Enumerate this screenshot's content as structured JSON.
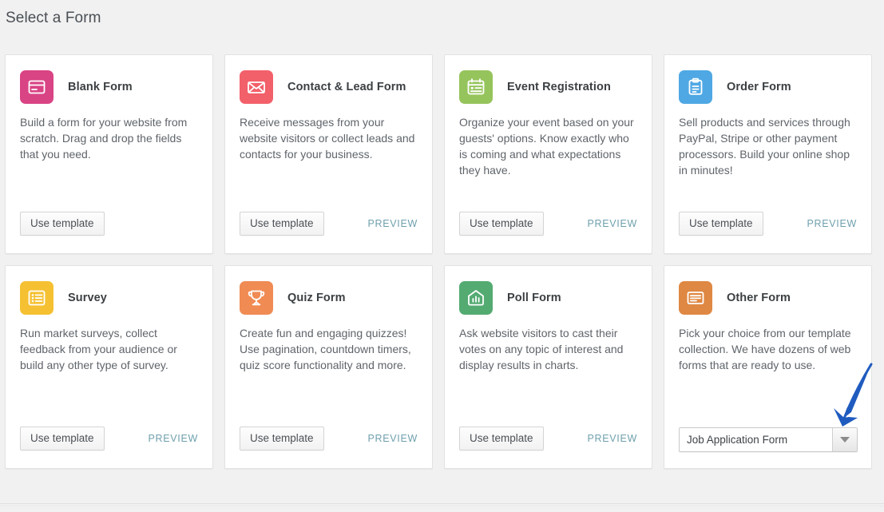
{
  "page": {
    "title": "Select a Form",
    "background_color": "#f1f1f1"
  },
  "labels": {
    "use_template": "Use template",
    "preview": "PREVIEW"
  },
  "cards": [
    {
      "id": "blank-form",
      "title": "Blank Form",
      "description": "Build a form for your website from scratch. Drag and drop the fields that you need.",
      "icon": "browser-window-icon",
      "icon_color": "#d94485",
      "use_template_label": "Use template",
      "preview_label": "",
      "has_preview": false
    },
    {
      "id": "contact-lead-form",
      "title": "Contact & Lead Form",
      "description": "Receive messages from your website visitors or collect leads and contacts for your business.",
      "icon": "envelope-icon",
      "icon_color": "#f2606a",
      "use_template_label": "Use template",
      "preview_label": "PREVIEW",
      "has_preview": true
    },
    {
      "id": "event-registration",
      "title": "Event Registration",
      "description": "Organize your event based on your guests' options. Know exactly who is coming and what expectations they have.",
      "icon": "calendar-icon",
      "icon_color": "#96c45c",
      "use_template_label": "Use template",
      "preview_label": "PREVIEW",
      "has_preview": true
    },
    {
      "id": "order-form",
      "title": "Order Form",
      "description": "Sell products and services through PayPal, Stripe or other payment processors. Build your online shop in minutes!",
      "icon": "clipboard-icon",
      "icon_color": "#4fa8e4",
      "use_template_label": "Use template",
      "preview_label": "PREVIEW",
      "has_preview": true
    },
    {
      "id": "survey",
      "title": "Survey",
      "description": "Run market surveys, collect feedback from your audience or build any other type of survey.",
      "icon": "list-table-icon",
      "icon_color": "#f5c132",
      "use_template_label": "Use template",
      "preview_label": "PREVIEW",
      "has_preview": true
    },
    {
      "id": "quiz-form",
      "title": "Quiz Form",
      "description": "Create fun and engaging quizzes! Use pagination, countdown timers, quiz score functionality and more.",
      "icon": "trophy-icon",
      "icon_color": "#f08b54",
      "use_template_label": "Use template",
      "preview_label": "PREVIEW",
      "has_preview": true
    },
    {
      "id": "poll-form",
      "title": "Poll Form",
      "description": "Ask website visitors to cast their votes on any topic of interest and display results in charts.",
      "icon": "bar-chart-icon",
      "icon_color": "#54ab72",
      "use_template_label": "Use template",
      "preview_label": "PREVIEW",
      "has_preview": true
    },
    {
      "id": "other-form",
      "title": "Other Form",
      "description": "Pick your choice from our template collection. We have dozens of web forms that are ready to use.",
      "icon": "article-icon",
      "icon_color": "#df8843",
      "use_template_label": "",
      "preview_label": "",
      "has_preview": false
    }
  ],
  "other_form_select": {
    "selected_value": "Job Application Form",
    "arrow_icon": "chevron-down-icon"
  },
  "annotation": {
    "type": "arrow",
    "color": "#1f5bbf",
    "points_to": "other-form-select-arrow"
  }
}
